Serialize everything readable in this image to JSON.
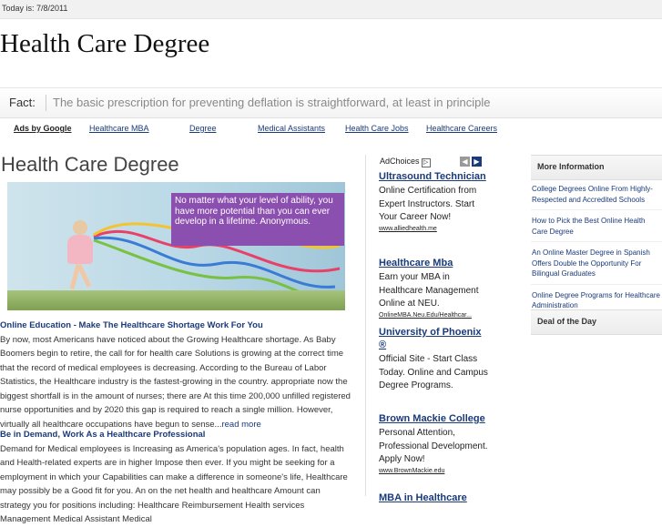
{
  "topbar": {
    "date_text": "Today is: 7/8/2011"
  },
  "site": {
    "title": "Health Care Degree"
  },
  "fact": {
    "label": "Fact:",
    "text": "The basic prescription for preventing deflation is straightforward, at least in principle"
  },
  "adnav": {
    "ads_by": "Ads by Google",
    "links": [
      "Healthcare MBA",
      "Degree",
      "Medical Assistants",
      "Health Care Jobs",
      "Healthcare Careers"
    ]
  },
  "main": {
    "title": "Health Care Degree",
    "hero_text": "No matter what your level of ability, you have more potential than you can ever develop in a lifetime. Anonymous.",
    "section1": {
      "heading": "Online Education - Make The Healthcare Shortage Work For You",
      "body": "By now, most Americans have noticed about the Growing Healthcare shortage. As Baby Boomers begin to retire, the call for for health care Solutions is growing at the correct time that the record of medical employees is decreasing. According to the Bureau of Labor Statistics, the Healthcare industry is the fastest-growing in the country. appropriate now the biggest shortfall is in the amount of nurses; there are At this time 200,000 unfilled registered nurse opportunities and by 2020 this gap is required to reach a single million. However, virtually all healthcare occupations have begun to sense...",
      "more": "read more"
    },
    "section2": {
      "heading": "Be in Demand, Work As a Healthcare Professional",
      "body": "Demand for Medical employees is Increasing as America's population ages. In fact, health and Health-related experts are in higher Impose then ever. If you might be seeking for a employment in which your Capabilities can make a difference in someone's life, Healthcare may possibly be a Good fit for you. An on the net health and healthcare Amount can strategy you for positions including: Healthcare Reimbursement Health services Management Medical Assistant Medical"
    }
  },
  "ads": {
    "adchoices": "AdChoices",
    "items": [
      {
        "title": "Ultrasound Technician",
        "desc": "Online Certification from Expert Instructors. Start Your Career Now!",
        "url": "www.alliedhealth.me"
      },
      {
        "title": "Healthcare Mba",
        "desc": "Earn your MBA in Healthcare Management Online at NEU.",
        "url": "OnlineMBA.Neu.Edu/Healthcar..."
      },
      {
        "title": "University of Phoenix ®",
        "desc": "Official Site - Start Class Today. Online and Campus Degree Programs.",
        "url": ""
      },
      {
        "title": "Brown Mackie College",
        "desc": "Personal Attention, Professional Development. Apply Now!",
        "url": "www.BrownMackie.edu"
      },
      {
        "title": "MBA in Healthcare",
        "desc": "",
        "url": ""
      }
    ]
  },
  "sidebar": {
    "more_info_title": "More Information",
    "links": [
      "College Degrees Online From Highly-Respected and Accredited Schools",
      "How to Pick the Best Online Health Care Degree",
      "An Online Master Degree in Spanish Offers Double the Opportunity For Bilingual Graduates",
      "Online Degree Programs for Healthcare Administration"
    ],
    "deal_title": "Deal of the Day"
  },
  "colors": {
    "link": "#1a3a7a",
    "banner": "#8b4fb0"
  }
}
